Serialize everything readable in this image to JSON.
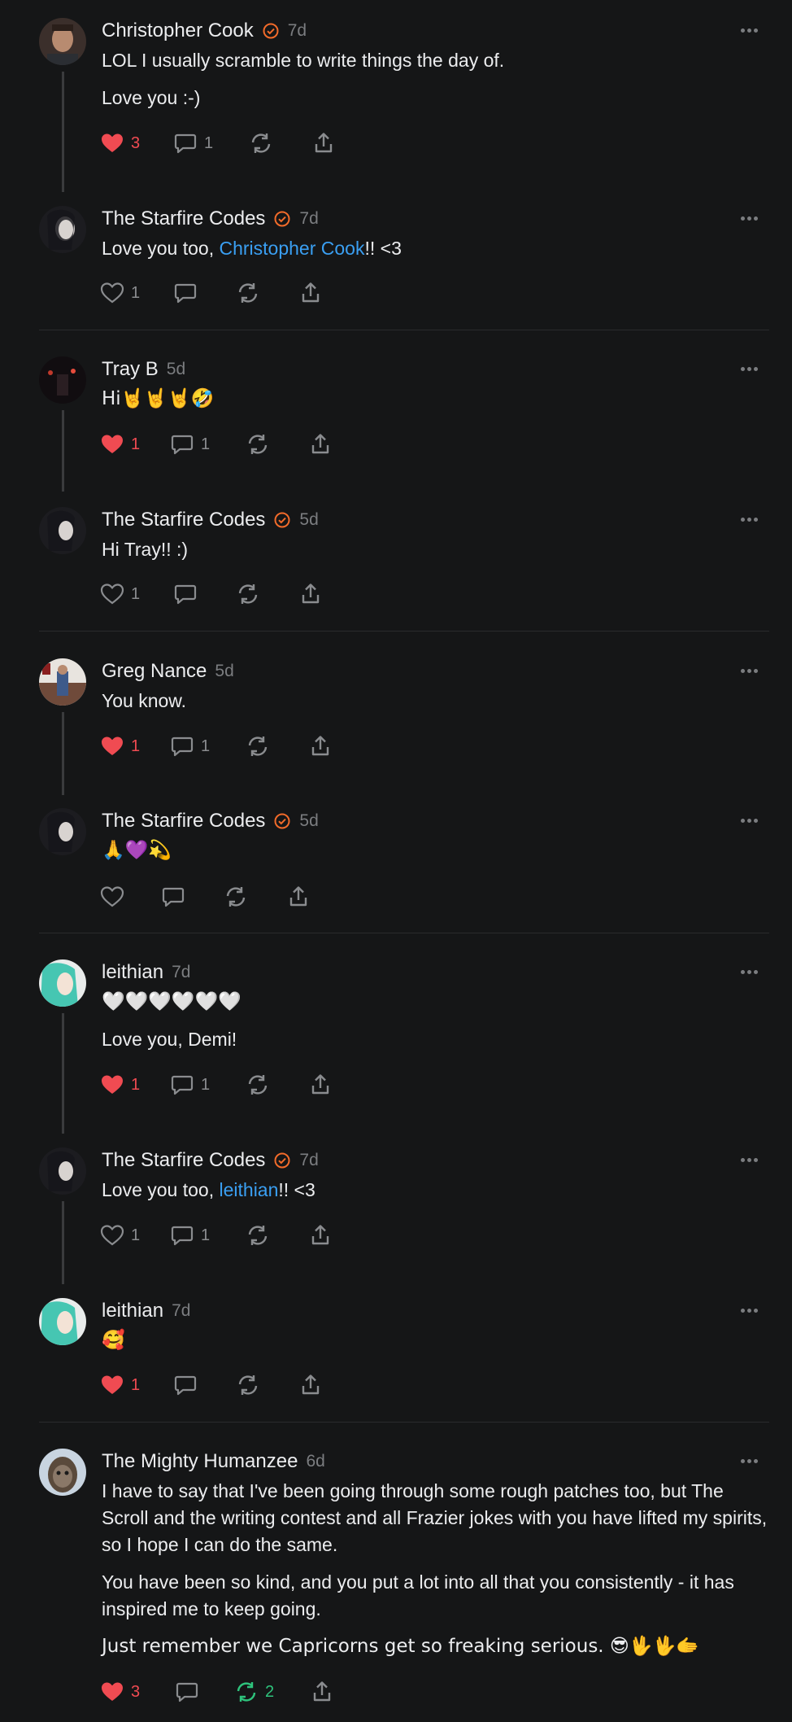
{
  "comments": [
    {
      "name": "Christopher Cook",
      "verified": true,
      "time": "7d",
      "paragraphs": [
        "LOL I usually scramble to write things the day of.",
        "Love you :-)"
      ],
      "likes": "3",
      "liked": true,
      "replies": "1",
      "reposts": ""
    },
    {
      "name": "The Starfire Codes",
      "verified": true,
      "time": "7d",
      "text_pre": "Love you too, ",
      "mention": "Christopher Cook",
      "text_post": "!! <3",
      "likes": "1",
      "liked": false,
      "replies": "",
      "reposts": ""
    },
    {
      "name": "Tray B",
      "verified": false,
      "time": "5d",
      "paragraphs": [
        "Hi🤘🤘🤘🤣"
      ],
      "likes": "1",
      "liked": true,
      "replies": "1",
      "reposts": ""
    },
    {
      "name": "The Starfire Codes",
      "verified": true,
      "time": "5d",
      "paragraphs": [
        "Hi Tray!! :)"
      ],
      "likes": "1",
      "liked": false,
      "replies": "",
      "reposts": ""
    },
    {
      "name": "Greg Nance",
      "verified": false,
      "time": "5d",
      "paragraphs": [
        "You know."
      ],
      "likes": "1",
      "liked": true,
      "replies": "1",
      "reposts": ""
    },
    {
      "name": "The Starfire Codes",
      "verified": true,
      "time": "5d",
      "paragraphs": [
        "🙏💜💫"
      ],
      "likes": "",
      "liked": false,
      "replies": "",
      "reposts": ""
    },
    {
      "name": "leithian",
      "verified": false,
      "time": "7d",
      "paragraphs": [
        "🤍🤍🤍🤍🤍🤍",
        "Love you, Demi!"
      ],
      "likes": "1",
      "liked": true,
      "replies": "1",
      "reposts": ""
    },
    {
      "name": "The Starfire Codes",
      "verified": true,
      "time": "7d",
      "text_pre": "Love you too, ",
      "mention": "leithian",
      "text_post": "!! <3",
      "likes": "1",
      "liked": false,
      "replies": "1",
      "reposts": ""
    },
    {
      "name": "leithian",
      "verified": false,
      "time": "7d",
      "paragraphs": [
        "🥰"
      ],
      "likes": "1",
      "liked": true,
      "replies": "",
      "reposts": ""
    },
    {
      "name": "The Mighty Humanzee",
      "verified": false,
      "time": "6d",
      "paragraphs": [
        "I have to say that I've been going through some rough patches too, but The Scroll and the writing contest and all Frazier jokes with you have lifted my spirits, so I hope I can do the same.",
        "You have been so kind, and you put a lot into all that you consistently - it has inspired me to keep going.",
        "Just remember we Capricorns get so freaking serious. 😎🖖🖖🫱"
      ],
      "likes": "3",
      "liked": true,
      "replies": "",
      "reposts": "2",
      "reposted": true
    }
  ],
  "colors": {
    "background": "#151617",
    "accent_verified": "#F26B2A",
    "like": "#F04B52",
    "repost": "#2EC37C",
    "link": "#3A9FF2"
  },
  "icons": [
    "heart-icon",
    "comment-icon",
    "repost-icon",
    "share-icon",
    "more-icon",
    "verified-icon"
  ]
}
